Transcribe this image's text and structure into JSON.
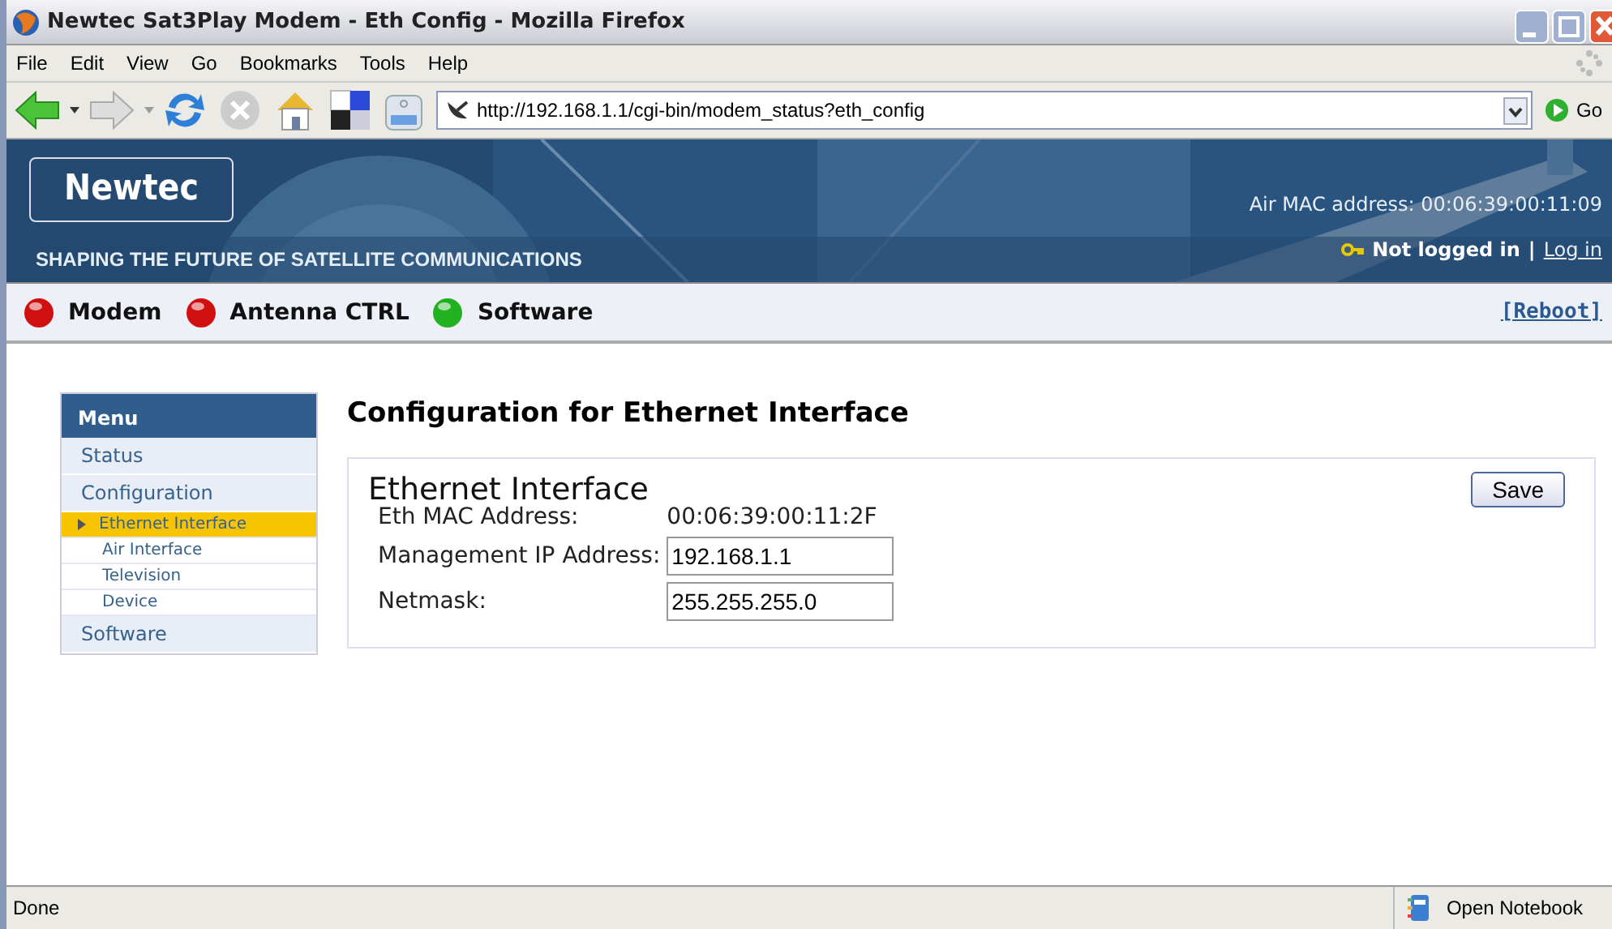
{
  "window": {
    "title": "Newtec Sat3Play Modem - Eth Config - Mozilla Firefox"
  },
  "menu_bar": [
    "File",
    "Edit",
    "View",
    "Go",
    "Bookmarks",
    "Tools",
    "Help"
  ],
  "address_bar": {
    "value": "http://192.168.1.1/cgi-bin/modem_status?eth_config",
    "go_label": "Go"
  },
  "banner": {
    "logo": "Newtec",
    "tagline": "SHAPING THE FUTURE OF SATELLITE COMMUNICATIONS",
    "air_mac": "Air MAC address: 00:06:39:00:11:09",
    "login_status": "Not logged in",
    "separator": "|",
    "login_link": "Log in"
  },
  "status_lights": [
    {
      "label": "Modem",
      "color": "#d01010"
    },
    {
      "label": "Antenna CTRL",
      "color": "#d01010"
    },
    {
      "label": "Software",
      "color": "#20b020"
    }
  ],
  "reboot_link": "[Reboot]",
  "sidebar": {
    "title": "Menu",
    "items": [
      {
        "label": "Status",
        "selected": false
      },
      {
        "label": "Configuration",
        "selected": false,
        "children": [
          {
            "label": "Ethernet Interface",
            "selected": true
          },
          {
            "label": "Air Interface",
            "selected": false
          },
          {
            "label": "Television",
            "selected": false
          },
          {
            "label": "Device",
            "selected": false
          }
        ]
      },
      {
        "label": "Software",
        "selected": false
      }
    ]
  },
  "page_title": "Configuration for Ethernet Interface",
  "panel": {
    "title": "Ethernet Interface",
    "save_button": "Save",
    "fields": [
      {
        "kind": "text",
        "label": "Eth MAC Address:",
        "value": "00:06:39:00:11:2F"
      },
      {
        "kind": "input",
        "label": "Management IP Address:",
        "value": "192.168.1.1"
      },
      {
        "kind": "input",
        "label": "Netmask:",
        "value": "255.255.255.0"
      }
    ]
  },
  "status_bar": {
    "text": "Done",
    "notebook": "Open Notebook"
  }
}
